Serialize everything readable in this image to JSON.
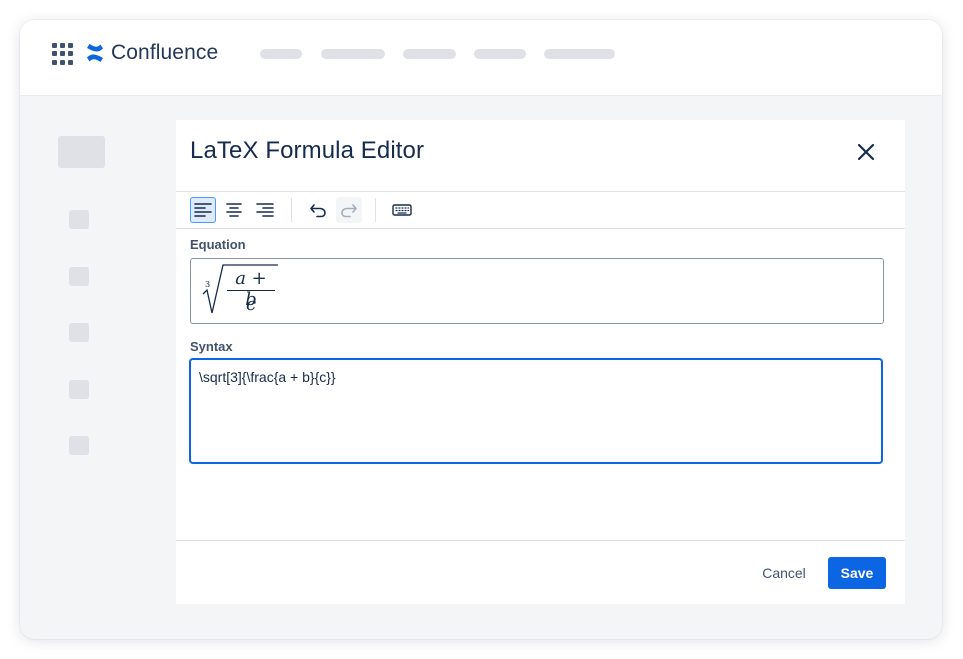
{
  "app": {
    "brand_name": "Confluence",
    "brand_color": "#0c66e4",
    "app_switcher_icon": "grid-icon",
    "brand_icon": "confluence-logo-icon"
  },
  "dialog": {
    "title": "LaTeX Formula Editor",
    "close_icon": "close-icon",
    "toolbar": {
      "align_left_icon": "align-left-icon",
      "align_center_icon": "align-center-icon",
      "align_right_icon": "align-right-icon",
      "undo_icon": "undo-icon",
      "redo_icon": "redo-icon",
      "keyboard_icon": "keyboard-icon",
      "active_alignment": "left",
      "redo_enabled": false
    },
    "equation": {
      "label": "Equation",
      "root_index": "3",
      "numerator": "a + b",
      "denominator": "c"
    },
    "syntax": {
      "label": "Syntax",
      "value": "\\sqrt[3]{\\frac{a + b}{c}}"
    },
    "actions": {
      "cancel_label": "Cancel",
      "save_label": "Save",
      "save_color": "#0c66e4"
    }
  }
}
